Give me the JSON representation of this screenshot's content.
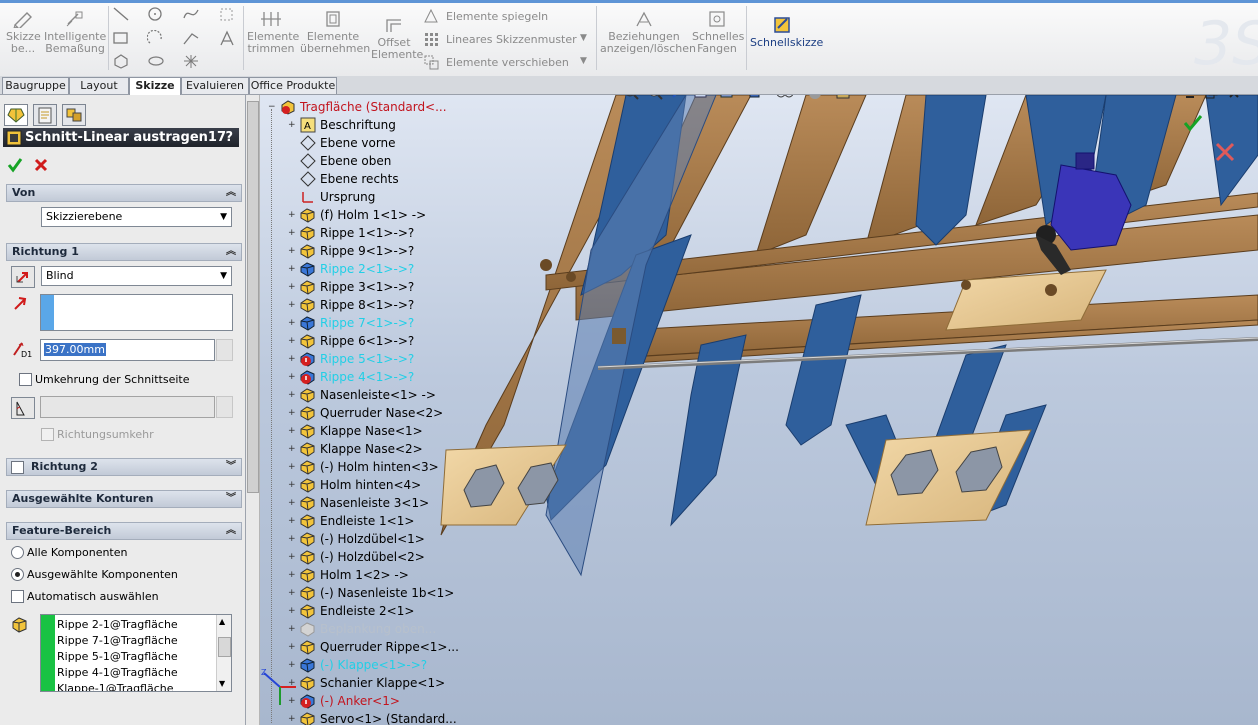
{
  "ribbon": {
    "skizze": "Skizze be...",
    "intelligente": "Intelligente Bemaßung",
    "elemente_trimmen": "Elemente trimmen",
    "elemente_uebernehmen": "Elemente übernehmen",
    "offset": "Offset Elemente",
    "spiegeln": "Elemente spiegeln",
    "lineares_muster": "Lineares Skizzenmuster",
    "verschieben": "Elemente verschieben",
    "beziehungen": "Beziehungen anzeigen/löschen",
    "schnelles_fangen": "Schnelles Fangen",
    "schnellskizze": "Schnellskizze"
  },
  "tabs": [
    "Baugruppe",
    "Layout",
    "Skizze",
    "Evaluieren",
    "Office Produkte"
  ],
  "panel": {
    "title": "Schnitt-Linear austragen17",
    "help": "?",
    "von": {
      "header": "Von",
      "value": "Skizzierebene"
    },
    "richtung1": {
      "header": "Richtung 1",
      "type": "Blind",
      "depth": "397.00mm",
      "depth_icon_label": "D1",
      "umkehrung": "Umkehrung der Schnittseite",
      "richtungsumkehr": "Richtungsumkehr"
    },
    "richtung2": {
      "header": "Richtung 2"
    },
    "konturen": {
      "header": "Ausgewählte Konturen"
    },
    "feature_bereich": {
      "header": "Feature-Bereich",
      "alle": "Alle Komponenten",
      "ausgewaehlte": "Ausgewählte Komponenten",
      "automatisch": "Automatisch auswählen",
      "list": [
        "Rippe 2-1@Tragfläche",
        "Rippe 7-1@Tragfläche",
        "Rippe 5-1@Tragfläche",
        "Rippe 4-1@Tragfläche",
        "Klappe-1@Tragfläche"
      ]
    }
  },
  "tree": [
    {
      "label": "Tragfläche  (Standard<...",
      "color": "red",
      "icon": "assembly-icon",
      "exp": "−",
      "indent": 0
    },
    {
      "label": "Beschriftung",
      "color": "black",
      "icon": "annotation-icon",
      "exp": "+",
      "indent": 1
    },
    {
      "label": "Ebene vorne",
      "color": "black",
      "icon": "plane-icon",
      "exp": "",
      "indent": 1
    },
    {
      "label": "Ebene oben",
      "color": "black",
      "icon": "plane-icon",
      "exp": "",
      "indent": 1
    },
    {
      "label": "Ebene rechts",
      "color": "black",
      "icon": "plane-icon",
      "exp": "",
      "indent": 1
    },
    {
      "label": "Ursprung",
      "color": "black",
      "icon": "origin-icon",
      "exp": "",
      "indent": 1
    },
    {
      "label": "(f) Holm 1<1> ->",
      "color": "black",
      "icon": "part-icon",
      "exp": "+",
      "indent": 1
    },
    {
      "label": "Rippe 1<1>->?",
      "color": "black",
      "icon": "part-icon",
      "exp": "+",
      "indent": 1
    },
    {
      "label": "Rippe 9<1>->?",
      "color": "black",
      "icon": "part-icon",
      "exp": "+",
      "indent": 1
    },
    {
      "label": "Rippe 2<1>->?",
      "color": "cyan",
      "icon": "part-blue-icon",
      "exp": "+",
      "indent": 1
    },
    {
      "label": "Rippe 3<1>->?",
      "color": "black",
      "icon": "part-icon",
      "exp": "+",
      "indent": 1
    },
    {
      "label": "Rippe 8<1>->?",
      "color": "black",
      "icon": "part-icon",
      "exp": "+",
      "indent": 1
    },
    {
      "label": "Rippe 7<1>->?",
      "color": "cyan",
      "icon": "part-blue-icon",
      "exp": "+",
      "indent": 1
    },
    {
      "label": "Rippe 6<1>->?",
      "color": "black",
      "icon": "part-icon",
      "exp": "+",
      "indent": 1
    },
    {
      "label": "Rippe 5<1>->?",
      "color": "cyan",
      "icon": "part-error-icon",
      "exp": "+",
      "indent": 1
    },
    {
      "label": "Rippe 4<1>->?",
      "color": "cyan",
      "icon": "part-error-icon",
      "exp": "+",
      "indent": 1
    },
    {
      "label": "Nasenleiste<1> ->",
      "color": "black",
      "icon": "part-icon",
      "exp": "+",
      "indent": 1
    },
    {
      "label": "Querruder Nase<2>",
      "color": "black",
      "icon": "part-icon",
      "exp": "+",
      "indent": 1
    },
    {
      "label": "Klappe Nase<1>",
      "color": "black",
      "icon": "part-icon",
      "exp": "+",
      "indent": 1
    },
    {
      "label": "Klappe Nase<2>",
      "color": "black",
      "icon": "part-icon",
      "exp": "+",
      "indent": 1
    },
    {
      "label": "(-) Holm hinten<3>",
      "color": "black",
      "icon": "part-icon",
      "exp": "+",
      "indent": 1
    },
    {
      "label": "Holm hinten<4>",
      "color": "black",
      "icon": "part-icon",
      "exp": "+",
      "indent": 1
    },
    {
      "label": "Nasenleiste 3<1>",
      "color": "black",
      "icon": "part-icon",
      "exp": "+",
      "indent": 1
    },
    {
      "label": "Endleiste 1<1>",
      "color": "black",
      "icon": "part-icon",
      "exp": "+",
      "indent": 1
    },
    {
      "label": "(-) Holzdübel<1>",
      "color": "black",
      "icon": "part-icon",
      "exp": "+",
      "indent": 1
    },
    {
      "label": "(-) Holzdübel<2>",
      "color": "black",
      "icon": "part-icon",
      "exp": "+",
      "indent": 1
    },
    {
      "label": "Holm 1<2> ->",
      "color": "black",
      "icon": "part-icon",
      "exp": "+",
      "indent": 1
    },
    {
      "label": "(-) Nasenleiste 1b<1>",
      "color": "black",
      "icon": "part-icon",
      "exp": "+",
      "indent": 1
    },
    {
      "label": "Endleiste 2<1>",
      "color": "black",
      "icon": "part-icon",
      "exp": "+",
      "indent": 1
    },
    {
      "label": "Beplankung oben...",
      "color": "gray",
      "icon": "part-gray-icon",
      "exp": "+",
      "indent": 1
    },
    {
      "label": "Querruder Rippe<1>...",
      "color": "black",
      "icon": "part-icon",
      "exp": "+",
      "indent": 1
    },
    {
      "label": "(-) Klappe<1>->?",
      "color": "cyan",
      "icon": "part-blue-icon",
      "exp": "+",
      "indent": 1
    },
    {
      "label": "Schanier Klappe<1>",
      "color": "black",
      "icon": "part-icon",
      "exp": "+",
      "indent": 1
    },
    {
      "label": "(-) Anker<1>",
      "color": "red",
      "icon": "part-error-icon",
      "exp": "+",
      "indent": 1
    },
    {
      "label": "Servo<1> (Standard...",
      "color": "black",
      "icon": "part-icon",
      "exp": "+",
      "indent": 1
    }
  ],
  "colors": {
    "accent": "#5f95d6",
    "confirm": "#16a325",
    "cancel": "#d01b1b",
    "rib_blue": "#2f5f9c",
    "wood": "#a87d4e"
  }
}
